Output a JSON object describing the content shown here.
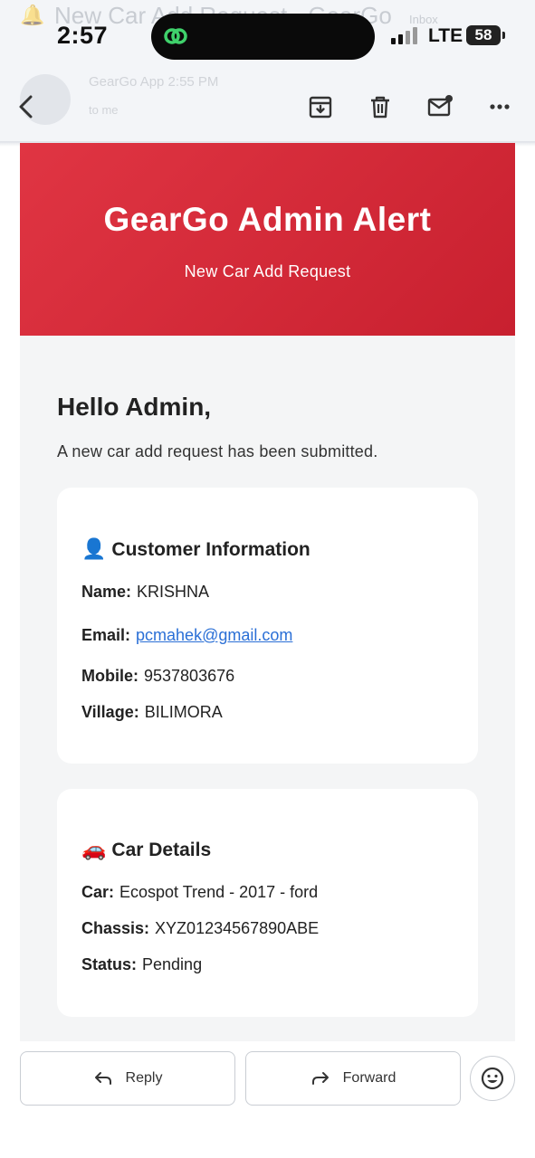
{
  "status_bar": {
    "time": "2:57",
    "network": "LTE",
    "battery": "58"
  },
  "ghost_header": {
    "subject": "New Car Add Request - GearGo",
    "label": "Inbox",
    "sender": "GearGo App   2:55 PM",
    "recipient": "to me"
  },
  "toolbar": {
    "back": "back-icon",
    "archive": "archive-icon",
    "delete": "trash-icon",
    "mark_unread": "mail-unread-icon",
    "more": "more-icon"
  },
  "email": {
    "hero_title": "GearGo Admin Alert",
    "hero_subtitle": "New Car Add Request",
    "greeting": "Hello Admin,",
    "intro": "A new car add request has been submitted.",
    "customer": {
      "emoji": "👤",
      "title": "Customer Information",
      "name_label": "Name:",
      "name": "KRISHNA",
      "email_label": "Email:",
      "email": "pcmahek@gmail.com",
      "mobile_label": "Mobile:",
      "mobile": "9537803676",
      "village_label": "Village:",
      "village": "BILIMORA"
    },
    "car": {
      "emoji": "🚗",
      "title": "Car Details",
      "car_label": "Car:",
      "car": "Ecospot Trend - 2017 - ford",
      "chassis_label": "Chassis:",
      "chassis": "XYZ01234567890ABE",
      "status_label": "Status:",
      "status": "Pending"
    }
  },
  "actions": {
    "reply": "Reply",
    "forward": "Forward",
    "emoji": "emoji-react-icon"
  },
  "colors": {
    "hero_start": "#e03543",
    "hero_end": "#c8202f",
    "link": "#2a6fd6",
    "email_bg": "#f4f5f6"
  }
}
